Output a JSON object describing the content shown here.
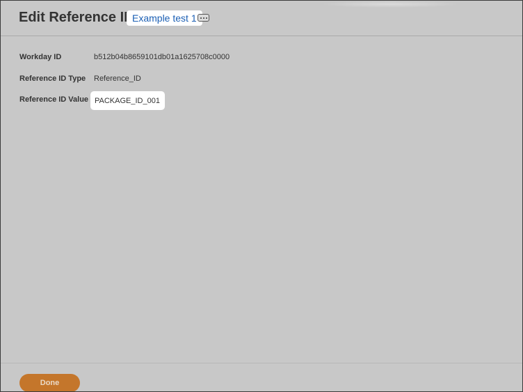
{
  "header": {
    "title": "Edit Reference ID",
    "object_name": "Example test 1",
    "related_actions_icon": "ellipsis-icon"
  },
  "fields": {
    "workday_id": {
      "label": "Workday ID",
      "value": "b512b04b8659101db01a1625708c0000"
    },
    "reference_id_type": {
      "label": "Reference ID Type",
      "value": "Reference_ID"
    },
    "reference_id_value": {
      "label": "Reference ID Value",
      "value": "PACKAGE_ID_001"
    }
  },
  "footer": {
    "done_label": "Done"
  },
  "colors": {
    "overlay_background": "#c8c8c8",
    "link_blue": "#1b5fb4",
    "primary_button": "#c4762b"
  }
}
